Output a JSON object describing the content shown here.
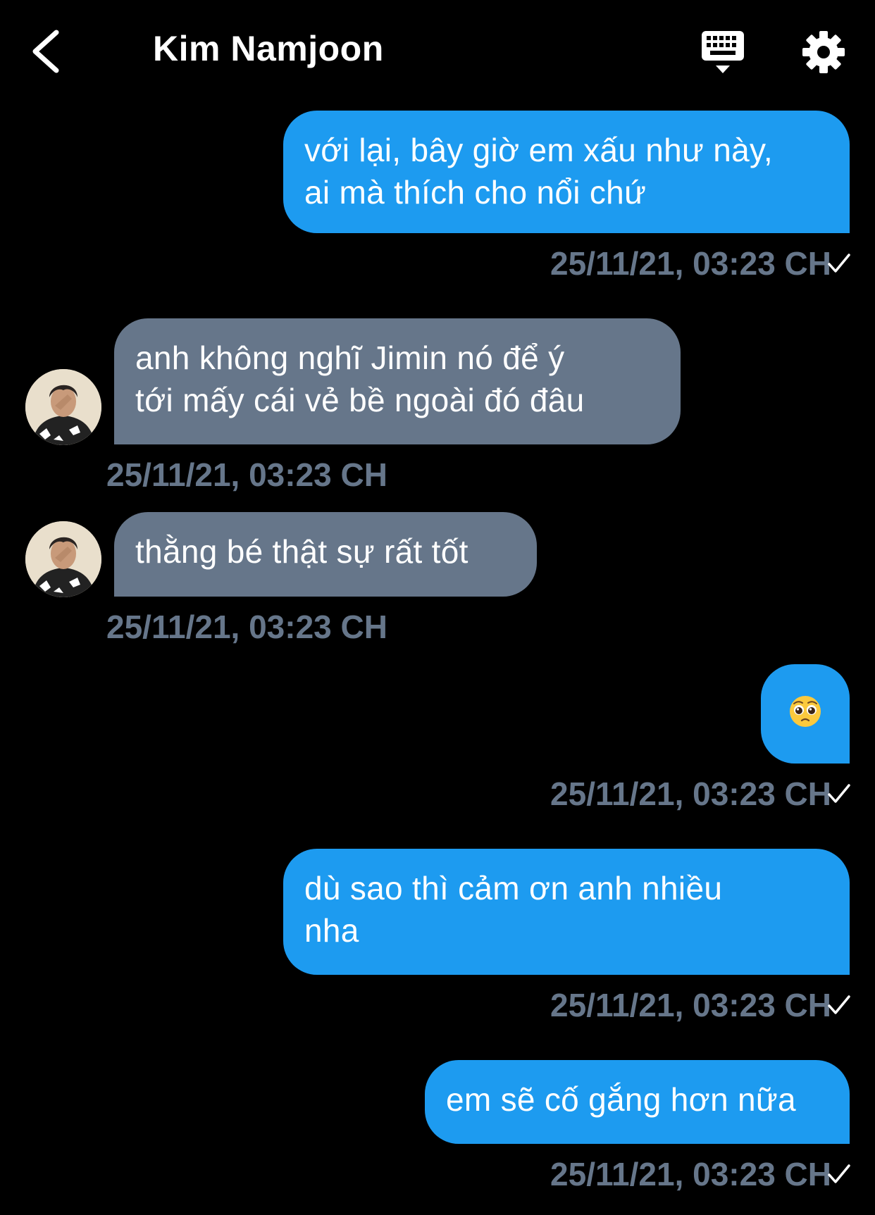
{
  "header": {
    "title": "Kim Namjoon",
    "back_icon": "chevron-left-icon",
    "keyboard_icon": "keyboard-icon",
    "settings_icon": "gear-icon"
  },
  "colors": {
    "background": "#000000",
    "outgoing_bubble": "#1d9bf0",
    "incoming_bubble": "#66768a",
    "timestamp": "#66768a"
  },
  "messages": [
    {
      "direction": "outgoing",
      "lines": [
        "với lại, bây giờ em xấu như này,",
        "ai mà thích cho nổi chứ"
      ],
      "timestamp": "25/11/21, 03:23 CH",
      "read_icon": "checkmark-icon"
    },
    {
      "direction": "incoming",
      "lines": [
        "anh không nghĩ Jimin nó để ý",
        "tới mấy cái vẻ bề ngoài đó đâu"
      ],
      "timestamp": "25/11/21, 03:23 CH"
    },
    {
      "direction": "incoming",
      "lines": [
        "thằng bé thật sự rất tốt"
      ],
      "timestamp": "25/11/21, 03:23 CH"
    },
    {
      "direction": "outgoing",
      "emoji": "pleading-face-emoji",
      "timestamp": "25/11/21, 03:23 CH",
      "read_icon": "checkmark-icon"
    },
    {
      "direction": "outgoing",
      "lines": [
        "dù sao thì cảm ơn anh nhiều",
        "nha"
      ],
      "timestamp": "25/11/21, 03:23 CH",
      "read_icon": "checkmark-icon"
    },
    {
      "direction": "outgoing",
      "lines": [
        "em sẽ cố gắng hơn nữa"
      ],
      "timestamp": "25/11/21, 03:23 CH",
      "read_icon": "checkmark-icon"
    }
  ]
}
